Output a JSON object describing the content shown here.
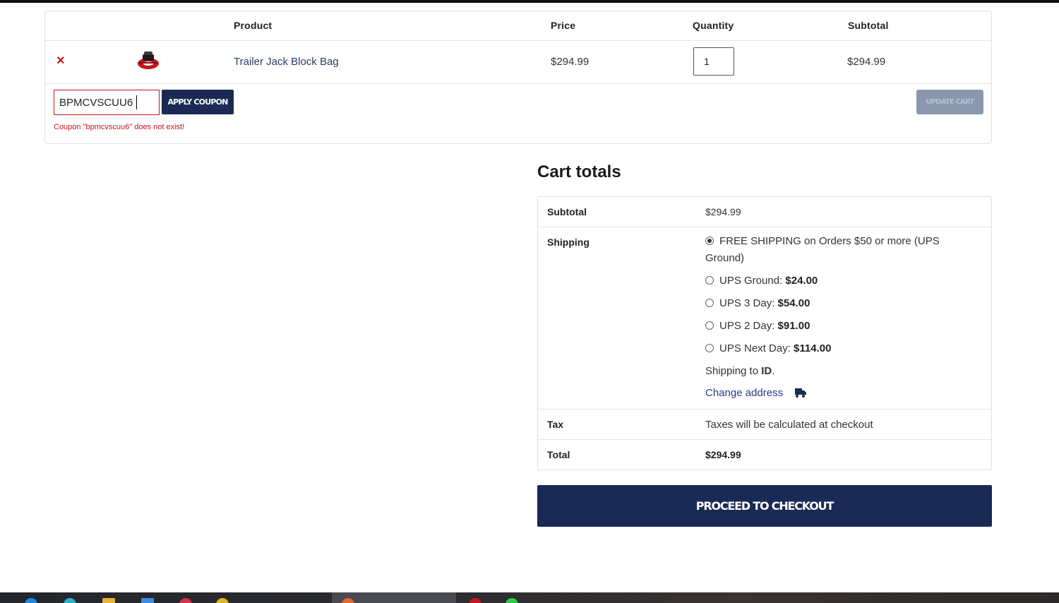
{
  "cart": {
    "headers": {
      "product": "Product",
      "price": "Price",
      "quantity": "Quantity",
      "subtotal": "Subtotal"
    },
    "item": {
      "remove": "×",
      "name": "Trailer Jack Block Bag",
      "price": "$294.99",
      "quantity": "1",
      "subtotal": "$294.99"
    },
    "coupon": {
      "value": "BPMCVSCUU6",
      "apply_label": "Apply coupon",
      "error": "Coupon \"bpmcvscuu6\" does not exist!"
    },
    "update_label": "Update cart"
  },
  "totals": {
    "title": "Cart totals",
    "subtotal_label": "Subtotal",
    "subtotal_value": "$294.99",
    "shipping_label": "Shipping",
    "shipping_options": [
      {
        "text": "FREE SHIPPING on Orders $50 or more (UPS Ground)",
        "price": "",
        "checked": true
      },
      {
        "text": "UPS Ground: ",
        "price": "$24.00",
        "checked": false
      },
      {
        "text": "UPS 3 Day: ",
        "price": "$54.00",
        "checked": false
      },
      {
        "text": "UPS 2 Day: ",
        "price": "$91.00",
        "checked": false
      },
      {
        "text": "UPS Next Day: ",
        "price": "$114.00",
        "checked": false
      }
    ],
    "shipping_to_prefix": "Shipping to ",
    "shipping_to_state": "ID",
    "shipping_to_suffix": ".",
    "change_address": "Change address",
    "tax_label": "Tax",
    "tax_value": "Taxes will be calculated at checkout",
    "total_label": "Total",
    "total_value": "$294.99"
  },
  "checkout_label": "Proceed to checkout",
  "icons": {
    "remove": "close-icon",
    "thumbnail": "product-thumbnail",
    "truck": "truck-icon"
  },
  "colors": {
    "brand_navy": "#1a2a55",
    "error_red": "#c4161c",
    "link": "#2a3a8a"
  }
}
